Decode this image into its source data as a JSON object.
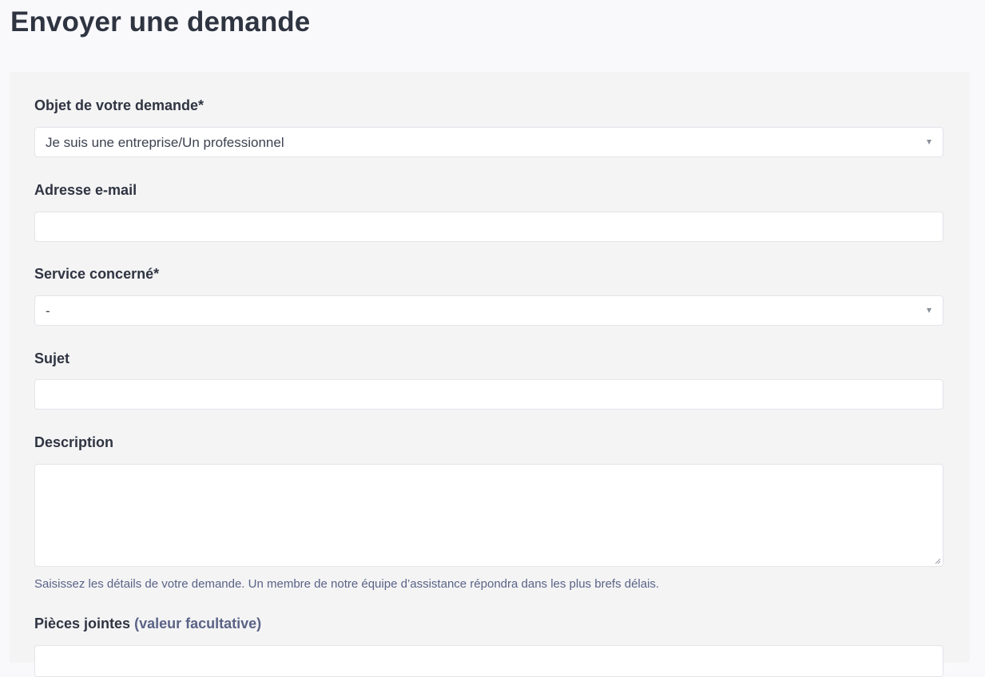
{
  "page": {
    "title": "Envoyer une demande"
  },
  "form": {
    "request_type": {
      "label": "Objet de votre demande*",
      "value": "Je suis une entreprise/Un professionnel"
    },
    "email": {
      "label": "Adresse e-mail",
      "value": ""
    },
    "service": {
      "label": "Service concerné*",
      "value": "-"
    },
    "subject": {
      "label": "Sujet",
      "value": ""
    },
    "description": {
      "label": "Description",
      "value": "",
      "hint": "Saisissez les détails de votre demande. Un membre de notre équipe d’assistance répondra dans les plus brefs délais."
    },
    "attachments": {
      "label": "Pièces jointes",
      "optional_note": "(valeur facultative)"
    }
  },
  "colors": {
    "page_bg": "#f9f9fc",
    "card_bg": "#f4f4f5",
    "text": "#2f3441",
    "muted": "#5a6386"
  },
  "icons": {
    "select_caret": "chevron-down-icon",
    "resize": "resize-handle-icon"
  }
}
